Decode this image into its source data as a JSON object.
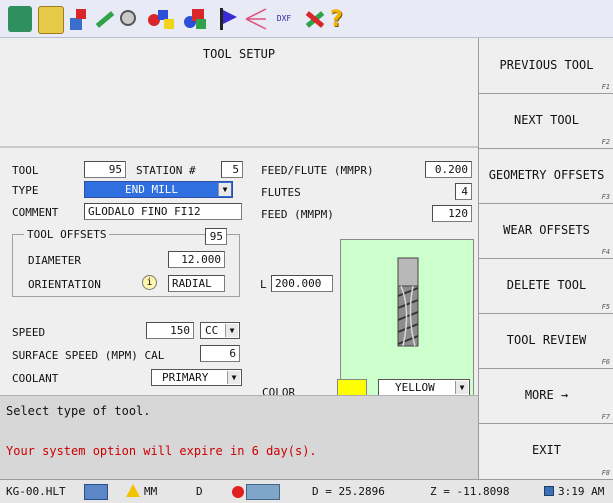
{
  "toolbar": {
    "icons": [
      "cube-icon",
      "chip-icon",
      "export-icon",
      "pencil-icon",
      "brush-icon",
      "shapes-icon",
      "flag-icon",
      "rays-icon",
      "dxf-icon",
      "wrench-icon",
      "help-icon"
    ],
    "dxf_label": "DXF"
  },
  "screen": {
    "title": "TOOL SETUP",
    "tool_label": "TOOL",
    "tool_value": "95",
    "station_label": "STATION #",
    "station_value": "5",
    "type_label": "TYPE",
    "type_value": "END MILL",
    "comment_label": "COMMENT",
    "comment_value": "GLODALO FINO FI12",
    "offsets_label": "TOOL OFFSETS",
    "offsets_value": "95",
    "diameter_label": "DIAMETER",
    "diameter_value": "12.000",
    "orientation_label": "ORIENTATION",
    "orientation_value": "RADIAL",
    "feed_flute_label": "FEED/FLUTE (MMPR)",
    "feed_flute_value": "0.200",
    "flutes_label": "FLUTES",
    "flutes_value": "4",
    "feed_label": "FEED (MMPM)",
    "feed_value": "120",
    "length_label": "L",
    "length_value": "200.000",
    "speed_label": "SPEED",
    "speed_value": "150",
    "speed_unit": "CC",
    "surface_label": "SURFACE SPEED (MPM) CAL",
    "surface_value": "6",
    "coolant_label": "COOLANT",
    "coolant_value": "PRIMARY",
    "color_label": "COLOR",
    "color_value": "YELLOW",
    "color_swatch": "#ffff00",
    "preview_bg": "#ccffcc"
  },
  "messages": {
    "hint": "Select type of tool.",
    "warning": "Your system option will expire in 6 day(s).",
    "warning_color": "#cc0000"
  },
  "softkeys": [
    {
      "label": "PREVIOUS TOOL",
      "key": "F1"
    },
    {
      "label": "NEXT TOOL",
      "key": "F2"
    },
    {
      "label": "GEOMETRY OFFSETS",
      "key": "F3"
    },
    {
      "label": "WEAR OFFSETS",
      "key": "F4"
    },
    {
      "label": "DELETE TOOL",
      "key": "F5"
    },
    {
      "label": "TOOL REVIEW",
      "key": "F6"
    },
    {
      "label": "MORE →",
      "key": "F7"
    },
    {
      "label": "EXIT",
      "key": "F8"
    }
  ],
  "status": {
    "file": "KG-00.HLT",
    "unit": "MM",
    "mode": "D",
    "d_readout": "D = 25.2896",
    "z_readout": "Z = -11.8098",
    "time": "3:19 AM"
  }
}
